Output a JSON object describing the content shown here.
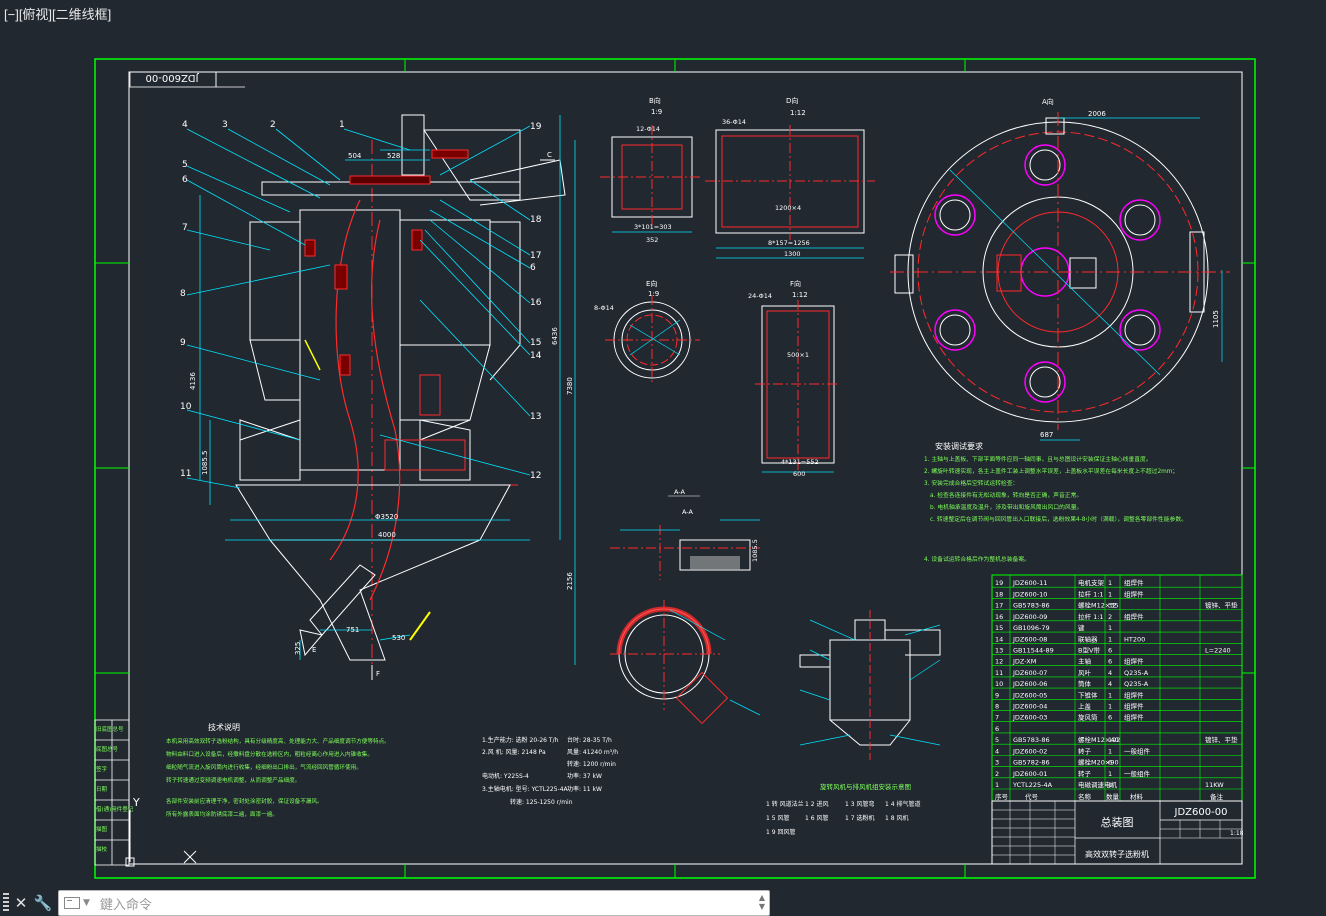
{
  "viewport": {
    "label": "[−][俯视][二维线框]"
  },
  "command": {
    "placeholder": "鍵入命令"
  },
  "toolbar": {
    "close_icon": "close-icon",
    "customize_icon": "wrench-icon"
  },
  "drawing": {
    "title_block": {
      "drawing_no": "JDZ600-00",
      "title": "总装图",
      "name": "高效双转子选粉机",
      "scale": "1:18",
      "motor": "11KW"
    },
    "frame_stamp": "JDZ600-00",
    "views": {
      "b": "B向",
      "b_scale": "1:9",
      "d": "D向",
      "d_scale": "1:12",
      "e": "E向",
      "e_scale": "1:9",
      "f": "F向",
      "f_scale": "1:12",
      "a": "A向",
      "aa": "A-A"
    },
    "dims": {
      "d504": "504",
      "d528": "528",
      "d4136": "4136",
      "d6436": "6436",
      "d7380": "7380",
      "d3520": "Φ3520",
      "d4000": "4000",
      "d2156": "2156",
      "d751": "751",
      "d530": "530",
      "d325": "325",
      "d1085": "1085.5",
      "d12x14": "12-Φ14",
      "d361": "3*101=303",
      "d352": "352",
      "d36x14": "36-Φ14",
      "d1200": "1200×4",
      "d1300": "1300",
      "d157": "8*157=1256",
      "d24x14": "24-Φ14",
      "d500": "500×1",
      "d131": "4*131=552",
      "d600": "600",
      "d2006": "2006",
      "d1105": "1105",
      "d687": "687",
      "d8x14": "8-Φ14"
    },
    "leaders": [
      "1",
      "2",
      "3",
      "4",
      "5",
      "6",
      "7",
      "8",
      "9",
      "10",
      "11",
      "12",
      "13",
      "14",
      "15",
      "16",
      "17",
      "18",
      "19"
    ],
    "notes_title": "安装调试要求",
    "notes": [
      "1. 主轴与上盖板、下部平面等件应同一轴同事，且与总图设计安装保证主轴心线垂直度。",
      "2. 螺旋叶转速实现，各主上盖件工装上调整水平误差，上盖板水平误差在每米长度上不超过2mm；",
      "3. 安装完成合格后空转试运转检查：",
      "a. 检查各连接件有无松动现象，转向是否正确，声音正常。",
      "b. 电机轴承温度及温升，涉及带出和旋风筒出风口的风量。",
      "c. 转速整定后在调节阀与回风管出入口联接后，选粉效果4-8小时（满载），调整各零部件性能参数。",
      "4. 设备试运转合格后作为整机总装备案。"
    ],
    "tech_title": "技术说明",
    "tech_lines": [
      "本机采用高效双转子选粉结构，具有分级精度高、处理能力大、产品细度调节方便等特点。",
      "物料由料口进入设备后，经撒料盘分散在选粉区内，粗粒经离心作用进入内锥收集。",
      "细粒随气流进入旋风筒内进行收集，经细粉出口排出，气流经回风管循环使用。",
      "转子转速通过变频调速电机调整，从而调整产品细度。",
      "各部件安装前应清理干净，密封处涂密封胶，保证设备不漏风。",
      "所有外露表面均涂防锈底漆二遍，面漆一遍。"
    ],
    "spec_lines": [
      "1.生产能力: 选粉 20-26 T/h",
      "2.风 机: 风量: 2148 Pa",
      "电动机: Y225S-4",
      "3.主轴电机: 型号: YCTL225-4A",
      "转速: 125-1250 r/min"
    ],
    "spec_lines_r": [
      "台时: 28-35 T/h",
      "风量: 41240 m³/h",
      "转速: 1200 r/min",
      "功率: 37 kW",
      "功率: 11 kW"
    ],
    "bom": [
      {
        "no": "19",
        "code": "JDZ600-11",
        "name": "电机支架",
        "qty": "1",
        "mat": "组焊件",
        "note": ""
      },
      {
        "no": "18",
        "code": "JDZ600-10",
        "name": "拉杆 1:1",
        "qty": "1",
        "mat": "组焊件",
        "note": ""
      },
      {
        "no": "17",
        "code": "GB5783-86",
        "name": "螺栓M12×35",
        "qty": "32",
        "mat": "",
        "note": "镀锌、平垫"
      },
      {
        "no": "16",
        "code": "JDZ600-09",
        "name": "拉杆 1:1",
        "qty": "2",
        "mat": "组焊件",
        "note": ""
      },
      {
        "no": "15",
        "code": "GB1096-79",
        "name": "键",
        "qty": "1",
        "mat": "",
        "note": ""
      },
      {
        "no": "14",
        "code": "JDZ600-08",
        "name": "联轴器",
        "qty": "1",
        "mat": "HT200",
        "note": ""
      },
      {
        "no": "13",
        "code": "GB11544-89",
        "name": "B型V带",
        "qty": "6",
        "mat": "",
        "note": "L=2240"
      },
      {
        "no": "12",
        "code": "JDZ-XM",
        "name": "主轴",
        "qty": "6",
        "mat": "组焊件",
        "note": ""
      },
      {
        "no": "11",
        "code": "JDZ600-07",
        "name": "风叶",
        "qty": "4",
        "mat": "Q235-A",
        "note": ""
      },
      {
        "no": "10",
        "code": "JDZ600-06",
        "name": "筒体",
        "qty": "4",
        "mat": "Q235-A",
        "note": ""
      },
      {
        "no": "9",
        "code": "JDZ600-05",
        "name": "下锥体",
        "qty": "1",
        "mat": "组焊件",
        "note": ""
      },
      {
        "no": "8",
        "code": "JDZ600-04",
        "name": "上盖",
        "qty": "1",
        "mat": "组焊件",
        "note": ""
      },
      {
        "no": "7",
        "code": "JDZ600-03",
        "name": "旋风筒",
        "qty": "6",
        "mat": "组焊件",
        "note": ""
      },
      {
        "no": "6",
        "code": "",
        "name": "",
        "qty": "",
        "mat": "",
        "note": ""
      },
      {
        "no": "5",
        "code": "GB5783-86",
        "name": "螺栓M12×40",
        "qty": "192",
        "mat": "",
        "note": "镀锌、平垫"
      },
      {
        "no": "4",
        "code": "JDZ600-02",
        "name": "转子",
        "qty": "1",
        "mat": "一般组件",
        "note": ""
      },
      {
        "no": "3",
        "code": "GB5782-86",
        "name": "螺栓M20×90",
        "qty": "6",
        "mat": "",
        "note": ""
      },
      {
        "no": "2",
        "code": "JDZ600-01",
        "name": "转子",
        "qty": "1",
        "mat": "一般组件",
        "note": ""
      },
      {
        "no": "1",
        "code": "YCTL225-4A",
        "name": "电磁调速电机",
        "qty": "1",
        "mat": "",
        "note": "11KW"
      }
    ],
    "bom_header": {
      "no": "序号",
      "code": "代号",
      "name": "名称",
      "qty": "数量",
      "mat": "材料",
      "note": "备注"
    },
    "side_labels": [
      "旧底图总号",
      "底图总号",
      "签字",
      "日期",
      "借(通)用件登记",
      "描图",
      "描校"
    ],
    "legend_title": "旋转风机与排风机组安装示意图",
    "legend_items": [
      "1 转 风道法兰",
      "1 2 进风",
      "1 3 风管弯",
      "1 4 排气管道",
      "1 5 风管",
      "1 6 风管",
      "1 7 选粉机",
      "1 8 风机",
      "1 9 回风管"
    ],
    "colors": {
      "bg": "#212830",
      "frame": "#00ff00",
      "line": "#ffffff",
      "center": "#ff2a2a",
      "cyan": "#00e5ff",
      "magenta": "#ff00ff",
      "yellow": "#ffff00",
      "textg": "#7fff5a"
    }
  }
}
